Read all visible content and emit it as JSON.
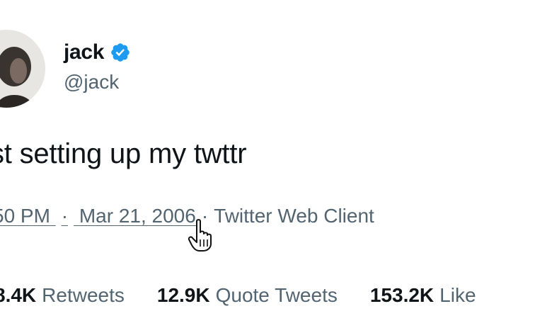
{
  "author": {
    "display_name": "jack",
    "handle": "@jack",
    "verified": true,
    "verified_color": "#1d9bf0"
  },
  "tweet": {
    "text": "st setting up my twttr"
  },
  "meta": {
    "time": "50 PM",
    "date": "Mar 21, 2006",
    "separator": "·",
    "client": "Twitter Web Client"
  },
  "stats": {
    "retweets_value": "8.4K",
    "retweets_label": "Retweets",
    "quote_tweets_value": "12.9K",
    "quote_tweets_label": "Quote Tweets",
    "likes_value": "153.2K",
    "likes_label": "Like"
  },
  "icons": {
    "avatar": "avatar",
    "verified": "verified-badge-icon",
    "cursor": "hand-pointer-cursor-icon"
  },
  "colors": {
    "text_primary": "#0f1419",
    "text_secondary": "#536471",
    "accent": "#1d9bf0"
  }
}
